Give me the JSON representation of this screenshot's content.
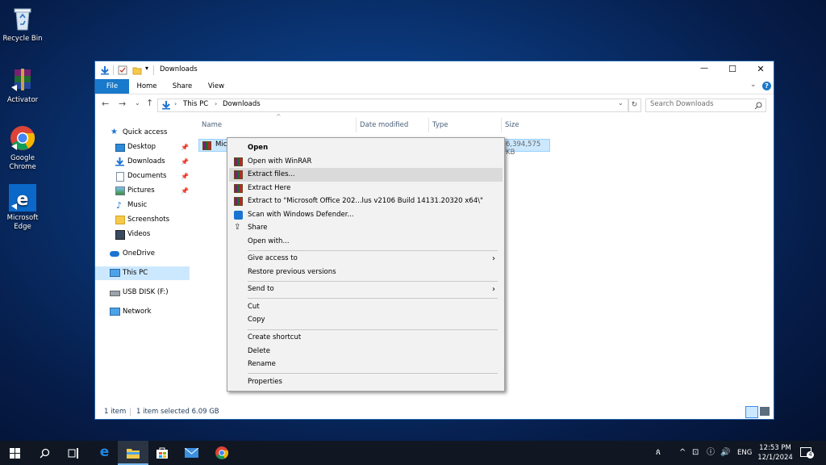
{
  "desktop": {
    "icons": [
      {
        "label": "Recycle Bin",
        "icon": "recycle-bin-icon"
      },
      {
        "label": "Activator",
        "icon": "winrar-icon"
      },
      {
        "label": "Google\nChrome",
        "line1": "Google",
        "line2": "Chrome",
        "icon": "chrome-icon"
      },
      {
        "label": "Microsoft\nEdge",
        "line1": "Microsoft",
        "line2": "Edge",
        "icon": "edge-icon"
      }
    ]
  },
  "window": {
    "title": "Downloads",
    "controls": {
      "minimize": "—",
      "maximize": "☐",
      "close": "✕"
    },
    "ribbon_tabs": [
      "File",
      "Home",
      "Share",
      "View"
    ],
    "address": {
      "crumbs": [
        "This PC",
        "Downloads"
      ],
      "search_placeholder": "Search Downloads"
    },
    "nav": {
      "quick_access": "Quick access",
      "items": [
        "Desktop",
        "Downloads",
        "Documents",
        "Pictures",
        "Music",
        "Screenshots",
        "Videos"
      ],
      "onedrive": "OneDrive",
      "this_pc": "This PC",
      "usb": "USB DISK (F:)",
      "network": "Network"
    },
    "columns": [
      "Name",
      "Date modified",
      "Type",
      "Size"
    ],
    "file": {
      "name": "Microsoft Office 2021 ProPlus v2106 Build 14131.20320 x64",
      "name_visible": "Mic",
      "size": "6,394,575 KB"
    },
    "status": {
      "items": "1 item",
      "selected": "1 item selected  6.09 GB"
    }
  },
  "context_menu": {
    "open": "Open",
    "open_with_winrar": "Open with WinRAR",
    "extract_files": "Extract files...",
    "extract_here": "Extract Here",
    "extract_to": "Extract to \"Microsoft Office 202...lus v2106 Build 14131.20320 x64\\\"",
    "scan": "Scan with Windows Defender...",
    "share": "Share",
    "open_with": "Open with...",
    "give_access": "Give access to",
    "restore": "Restore previous versions",
    "send_to": "Send to",
    "cut": "Cut",
    "copy": "Copy",
    "create_shortcut": "Create shortcut",
    "delete": "Delete",
    "rename": "Rename",
    "properties": "Properties"
  },
  "taskbar": {
    "time": "12:53 PM",
    "date": "12/1/2024",
    "language": "ENG",
    "notifications": "4"
  },
  "colors": {
    "accent": "#0078d7",
    "taskbar": "#101723",
    "selection": "#cce8ff",
    "menu_hover": "#dadada"
  }
}
